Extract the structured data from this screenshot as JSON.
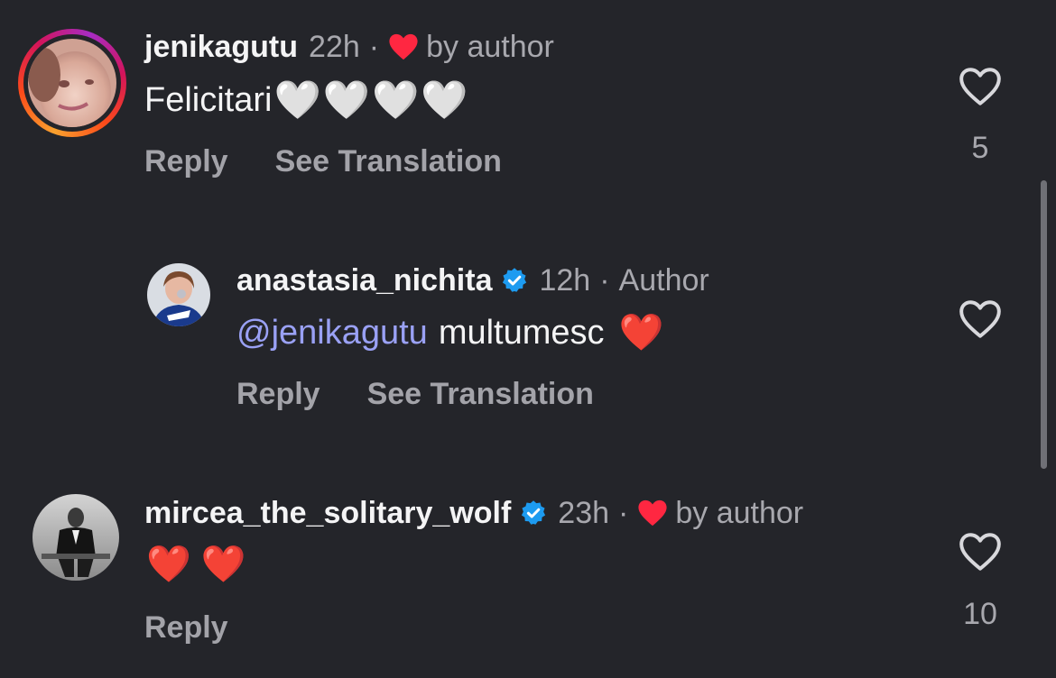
{
  "comments": [
    {
      "username": "jenikagutu",
      "time": "22h",
      "separator": "·",
      "badge": "by author",
      "text": "Felicitari",
      "emojis": "🤍🤍🤍🤍",
      "reply_label": "Reply",
      "translate_label": "See Translation",
      "like_count": "5"
    },
    {
      "username": "anastasia_nichita",
      "time": "12h",
      "separator": "·",
      "badge": "Author",
      "mention": "@jenikagutu",
      "text": "multumesc",
      "emojis": "❤️",
      "reply_label": "Reply",
      "translate_label": "See Translation",
      "like_count": ""
    },
    {
      "username": "mircea_the_solitary_wolf",
      "time": "23h",
      "separator": "·",
      "badge": "by author",
      "emojis": "❤️ ❤️",
      "reply_label": "Reply",
      "like_count": "10"
    }
  ],
  "icons": {
    "verified": "verified-badge-icon",
    "like": "heart-outline-icon",
    "liked_by_author": "heart-filled-icon"
  },
  "colors": {
    "background": "#24252a",
    "verified": "#1d9bf0",
    "heart_red": "#ff2741",
    "mention": "#9aa1f5",
    "secondary_text": "#a8a8ae"
  }
}
